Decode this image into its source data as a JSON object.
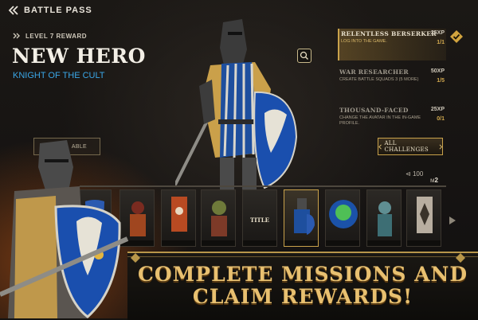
{
  "topbar": {
    "title": "BATTLE PASS",
    "back_icon": "chevron-left-icon"
  },
  "reward": {
    "level_label": "LEVEL 7 REWARD",
    "title": "NEW HERO",
    "subtitle": "KNIGHT OF THE CULT"
  },
  "challenges": [
    {
      "name": "RELENTLESS BERSERKER",
      "desc": "LOG INTO THE GAME.",
      "xp": "25XP",
      "progress": "1/1",
      "active": true,
      "completed": true
    },
    {
      "name": "WAR RESEARCHER",
      "desc": "CREATE BATTLE SQUADS 3 (5 MORE)",
      "xp": "50XP",
      "progress": "1/5",
      "active": false
    },
    {
      "name": "THOUSAND-FACED",
      "desc": "CHANGE THE AVATAR IN THE IN-GAME PROFILE.",
      "xp": "25XP",
      "progress": "0/1",
      "active": false
    }
  ],
  "buttons": {
    "all_challenges": "ALL CHALLENGES",
    "unavailable": "ABLE"
  },
  "track": {
    "xp_value": "100",
    "tier_value": "2"
  },
  "cards": [
    {
      "name": "card-knight-shield"
    },
    {
      "name": "card-red-warrior"
    },
    {
      "name": "card-banner"
    },
    {
      "name": "card-orc"
    },
    {
      "name": "card-title",
      "label": "TITLE"
    },
    {
      "name": "card-knight-hero",
      "selected": true
    },
    {
      "name": "card-green-creature"
    },
    {
      "name": "card-undead"
    },
    {
      "name": "card-emblem"
    }
  ],
  "banner": {
    "line1": "COMPLETE MISSIONS AND",
    "line2": "CLAIM REWARDS!"
  },
  "colors": {
    "accent_gold": "#c9a24b",
    "subtitle_blue": "#3aa7e8",
    "banner_gold": "#e8c070"
  }
}
